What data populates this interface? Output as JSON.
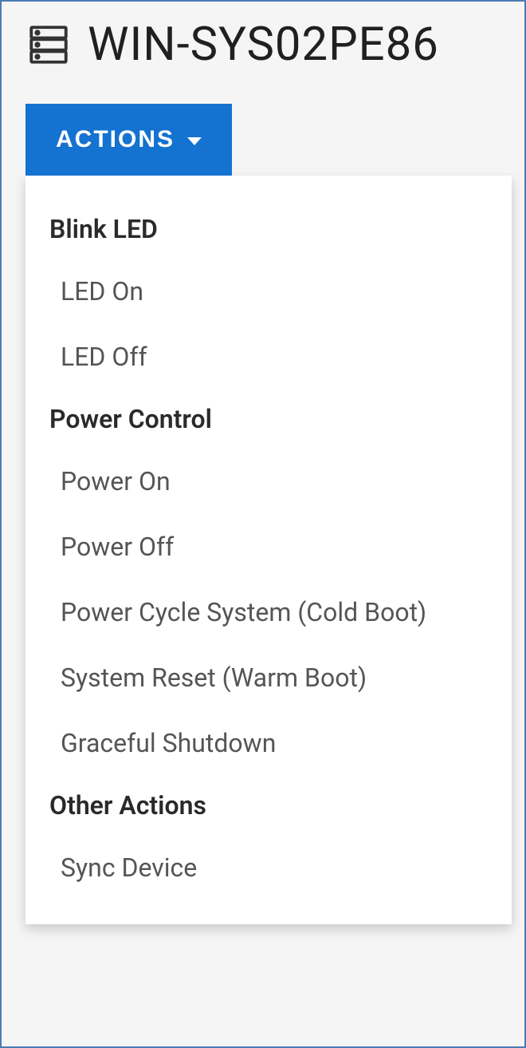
{
  "header": {
    "title": "WIN-SYS02PE86"
  },
  "actions_button": {
    "label": "ACTIONS"
  },
  "menu": {
    "sections": [
      {
        "header": "Blink LED",
        "items": [
          {
            "label": "LED On"
          },
          {
            "label": "LED Off"
          }
        ]
      },
      {
        "header": "Power Control",
        "items": [
          {
            "label": "Power On"
          },
          {
            "label": "Power Off"
          },
          {
            "label": "Power Cycle System (Cold Boot)"
          },
          {
            "label": "System Reset (Warm Boot)"
          },
          {
            "label": "Graceful Shutdown"
          }
        ]
      },
      {
        "header": "Other Actions",
        "items": [
          {
            "label": "Sync Device"
          }
        ]
      }
    ]
  },
  "colors": {
    "accent": "#1472d0",
    "border": "#4a7cb5"
  }
}
